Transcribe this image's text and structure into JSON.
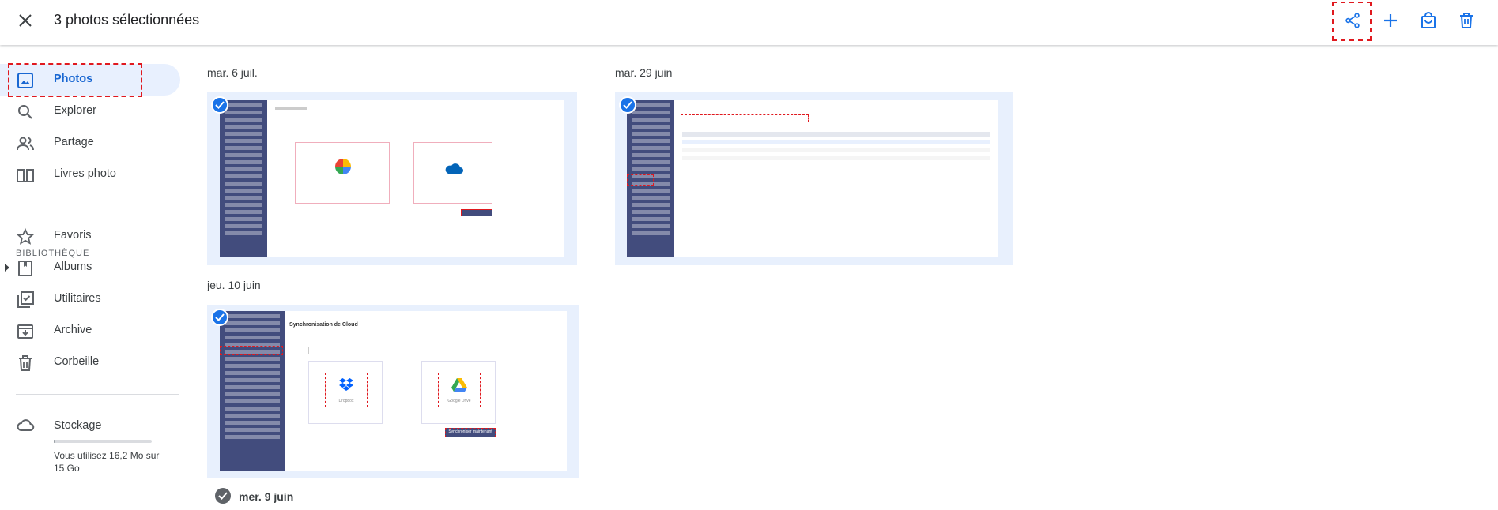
{
  "topbar": {
    "title": "3 photos sélectionnées"
  },
  "actions": [
    {
      "name": "share-button",
      "icon": "share-icon"
    },
    {
      "name": "add-to-button",
      "icon": "plus-icon"
    },
    {
      "name": "order-photos-button",
      "icon": "shopping-bag-icon"
    },
    {
      "name": "delete-button",
      "icon": "trash-icon"
    }
  ],
  "sidebar": {
    "items": [
      {
        "label": "Photos",
        "icon": "image-icon",
        "active": true
      },
      {
        "label": "Explorer",
        "icon": "search-icon"
      },
      {
        "label": "Partage",
        "icon": "people-icon"
      },
      {
        "label": "Livres photo",
        "icon": "book-icon"
      }
    ],
    "section": "BIBLIOTHÈQUE",
    "library": [
      {
        "label": "Favoris",
        "icon": "star-icon"
      },
      {
        "label": "Albums",
        "icon": "album-icon"
      },
      {
        "label": "Utilitaires",
        "icon": "checklist-icon"
      },
      {
        "label": "Archive",
        "icon": "archive-icon"
      },
      {
        "label": "Corbeille",
        "icon": "trash-icon"
      }
    ],
    "storage": {
      "label": "Stockage",
      "usage": "Vous utilisez 16,2 Mo sur 15 Go",
      "used_fraction": 0.001
    }
  },
  "groups": [
    {
      "date": "mar. 6 juil."
    },
    {
      "date": "mar. 29 juin"
    },
    {
      "date": "jeu. 10 juin"
    },
    {
      "date": "mer. 9 juin"
    }
  ],
  "thumb3": {
    "heading": "Synchronisation de Cloud",
    "source": "Dropbox",
    "target": "Google Drive",
    "button": "Synchroniser maintenant"
  },
  "colors": {
    "accent": "#1a73e8",
    "highlight": "#e0191f",
    "active_bg": "#e8f0fe"
  }
}
